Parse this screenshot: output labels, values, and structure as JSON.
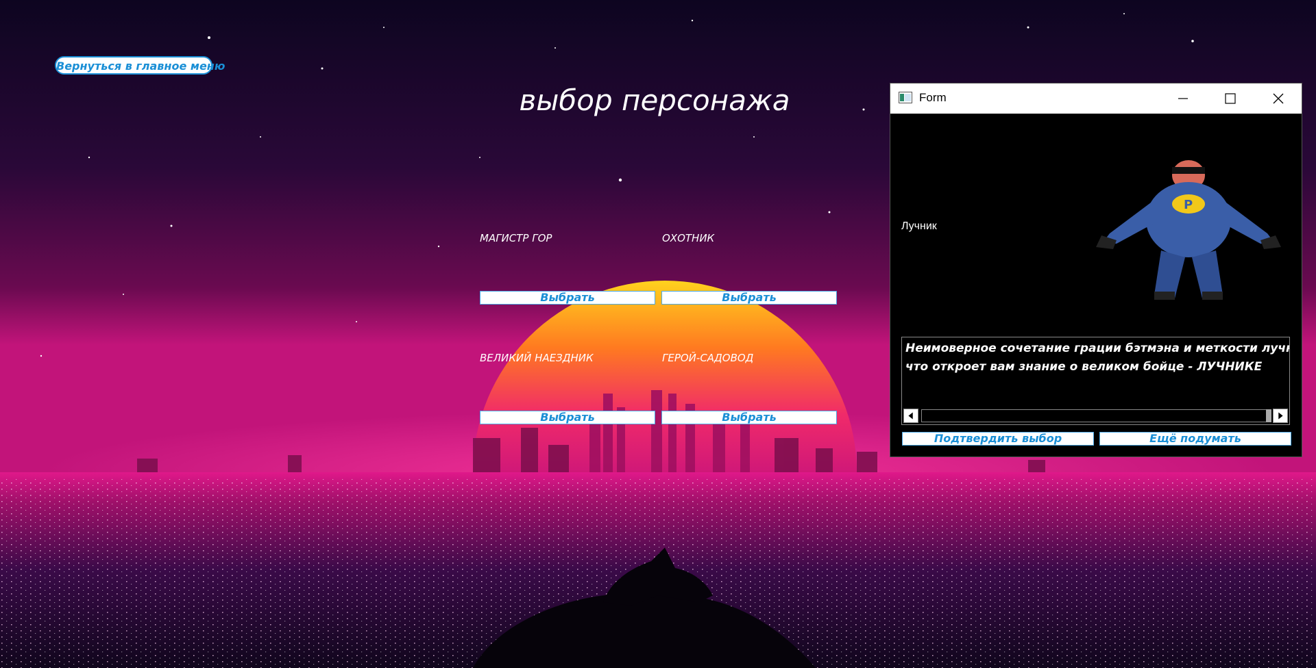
{
  "header": {
    "back_label": "Вернуться в главное меню",
    "title": "выбор персонажа"
  },
  "characters": [
    {
      "name": "МАГИСТР ГОР",
      "button": "Выбрать"
    },
    {
      "name": "ОХОТНИК",
      "button": "Выбрать"
    },
    {
      "name": "ВЕЛИКИЙ НАЕЗДНИК",
      "button": "Выбрать"
    },
    {
      "name": "ГЕРОЙ-САДОВОД",
      "button": "Выбрать"
    }
  ],
  "form": {
    "window_title": "Form",
    "character_label": "Лучник",
    "description_line1": "Неимоверное сочетание грации бэтмэна и меткости лучника",
    "description_line2": "что откроет вам знание о великом бойце - ЛУЧНИКЕ",
    "confirm_label": "Подтвердить выбор",
    "rethink_label": "Ещё подумать"
  },
  "colors": {
    "accent": "#1a8fd6",
    "sun_top": "#ffc21a",
    "sun_bottom": "#e0157a",
    "sky": "#1a0630"
  },
  "icons": [
    "minimize-icon",
    "maximize-icon",
    "close-icon",
    "app-icon",
    "arrow-left-icon",
    "arrow-right-icon"
  ]
}
